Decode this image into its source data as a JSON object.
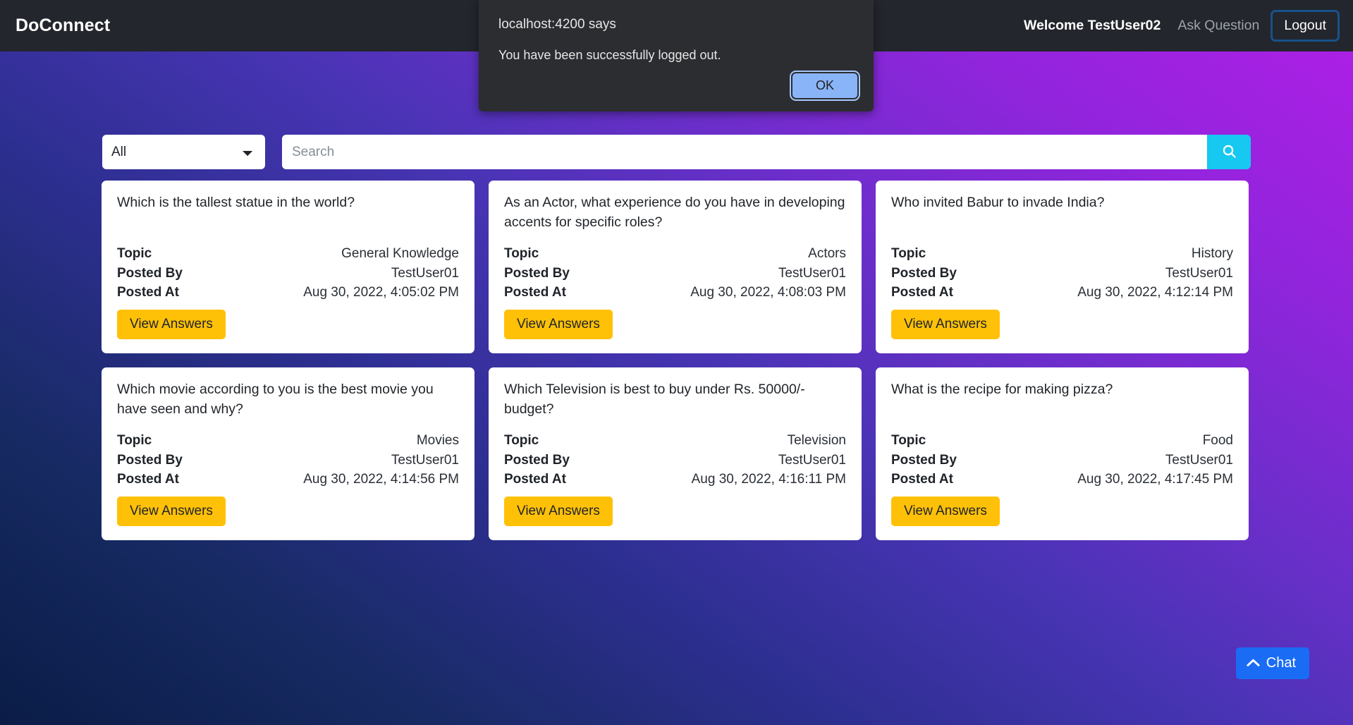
{
  "navbar": {
    "brand": "DoConnect",
    "welcome": "Welcome TestUser02",
    "ask_question": "Ask Question",
    "logout": "Logout"
  },
  "alert": {
    "origin": "localhost:4200 says",
    "message": "You have been successfully logged out.",
    "ok_label": "OK"
  },
  "search": {
    "selected_topic": "All",
    "topic_options": [
      "All"
    ],
    "placeholder": "Search",
    "value": "",
    "search_icon": "search-icon"
  },
  "labels": {
    "topic": "Topic",
    "posted_by": "Posted By",
    "posted_at": "Posted At",
    "view_answers": "View Answers"
  },
  "questions": [
    {
      "title": "Which is the tallest statue in the world?",
      "topic": "General Knowledge",
      "posted_by": "TestUser01",
      "posted_at": "Aug 30, 2022, 4:05:02 PM"
    },
    {
      "title": "As an Actor, what experience do you have in developing accents for specific roles?",
      "topic": "Actors",
      "posted_by": "TestUser01",
      "posted_at": "Aug 30, 2022, 4:08:03 PM"
    },
    {
      "title": "Who invited Babur to invade India?",
      "topic": "History",
      "posted_by": "TestUser01",
      "posted_at": "Aug 30, 2022, 4:12:14 PM"
    },
    {
      "title": "Which movie according to you is the best movie you have seen and why?",
      "topic": "Movies",
      "posted_by": "TestUser01",
      "posted_at": "Aug 30, 2022, 4:14:56 PM"
    },
    {
      "title": "Which Television is best to buy under Rs. 50000/- budget?",
      "topic": "Television",
      "posted_by": "TestUser01",
      "posted_at": "Aug 30, 2022, 4:16:11 PM"
    },
    {
      "title": "What is the recipe for making pizza?",
      "topic": "Food",
      "posted_by": "TestUser01",
      "posted_at": "Aug 30, 2022, 4:17:45 PM"
    }
  ],
  "chat": {
    "label": "Chat",
    "icon": "chevron-up-icon"
  },
  "colors": {
    "navbar_bg": "#23262c",
    "accent_yellow": "#ffc107",
    "accent_cyan": "#17c8f0",
    "chat_blue": "#1a6cf5",
    "dialog_bg": "#2b2d30",
    "dialog_ok_bg": "#8ab4f8",
    "bg_gradient_start": "#0a1c46",
    "bg_gradient_end": "#b01fe6"
  }
}
